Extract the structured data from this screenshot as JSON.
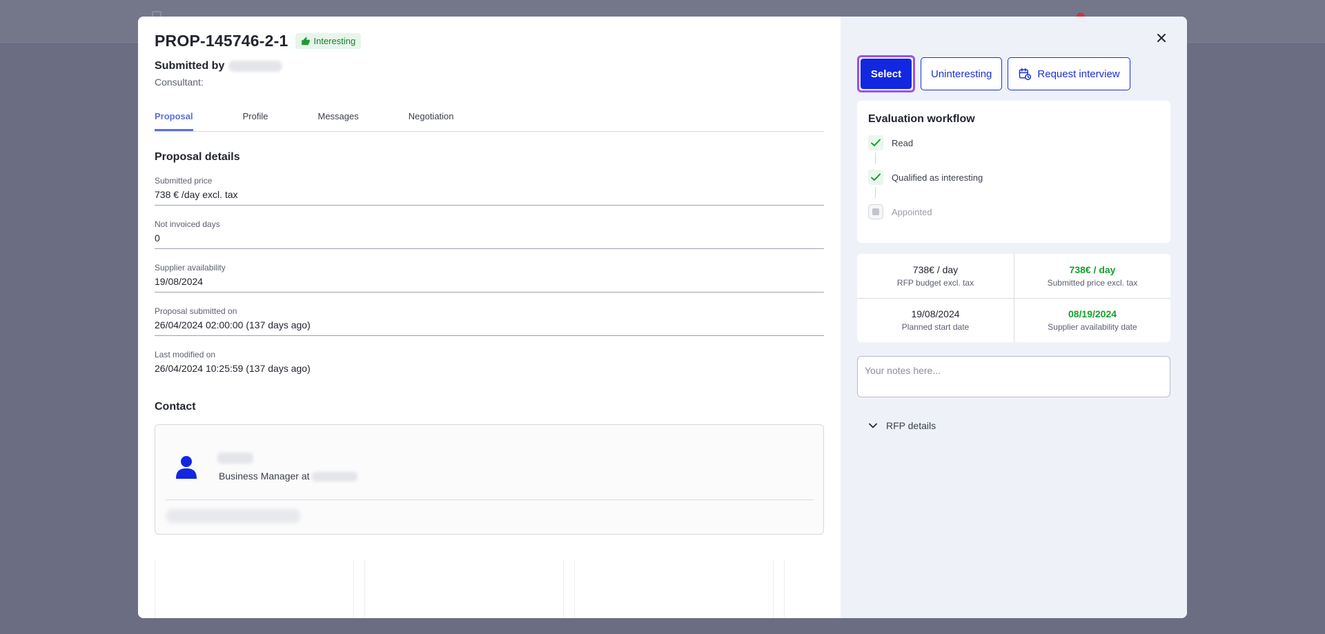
{
  "header": {
    "title": "PROP-145746-2-1",
    "badge": "Interesting",
    "submitted_by_label": "Submitted by",
    "consultant_label": "Consultant:"
  },
  "tabs": [
    {
      "label": "Proposal",
      "active": true
    },
    {
      "label": "Profile",
      "active": false
    },
    {
      "label": "Messages",
      "active": false
    },
    {
      "label": "Negotiation",
      "active": false
    }
  ],
  "proposal_details": {
    "title": "Proposal details",
    "fields": [
      {
        "label": "Submitted price",
        "value": "738 € /day excl. tax"
      },
      {
        "label": "Not invoiced days",
        "value": "0"
      },
      {
        "label": "Supplier availability",
        "value": "19/08/2024"
      },
      {
        "label": "Proposal submitted on",
        "value": "26/04/2024 02:00:00 (137 days ago)"
      },
      {
        "label": "Last modified on",
        "value": "26/04/2024 10:25:59 (137 days ago)"
      }
    ]
  },
  "contact": {
    "title": "Contact",
    "role": "Business Manager at"
  },
  "actions": {
    "select": "Select",
    "uninteresting": "Uninteresting",
    "request_interview": "Request interview"
  },
  "workflow": {
    "title": "Evaluation workflow",
    "steps": [
      {
        "label": "Read",
        "done": true
      },
      {
        "label": "Qualified as interesting",
        "done": true
      },
      {
        "label": "Appointed",
        "done": false
      }
    ]
  },
  "stats": [
    {
      "value": "738€ / day",
      "label": "RFP budget excl. tax"
    },
    {
      "value": "738€ / day",
      "label": "Submitted price excl. tax"
    },
    {
      "value": "19/08/2024",
      "label": "Planned start date"
    },
    {
      "value": "08/19/2024",
      "label": "Supplier availability date"
    }
  ],
  "notes": {
    "placeholder": "Your notes here...",
    "value": ""
  },
  "rfp_details": "RFP details",
  "colors": {
    "primary": "#1227e0",
    "focus_ring": "#9b52e8",
    "tab_active": "#5a6fe0",
    "success": "#14a02c"
  },
  "icons": [
    "thumbs-up-icon",
    "close-icon",
    "calendar-clock-icon",
    "check-icon",
    "person-icon",
    "chevron-down-icon"
  ]
}
